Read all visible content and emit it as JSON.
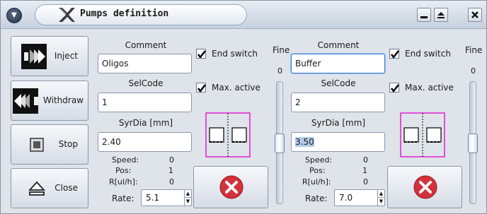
{
  "window": {
    "title": "Pumps definition"
  },
  "actions": {
    "inject": "Inject",
    "withdraw": "Withdraw",
    "stop": "Stop",
    "close": "Close"
  },
  "pumps": [
    {
      "comment_label": "Comment",
      "comment_value": "Oligos",
      "end_switch_label": "End switch",
      "end_switch_checked": true,
      "selcode_label": "SelCode",
      "selcode_value": "1",
      "max_active_label": "Max. active",
      "max_active_checked": true,
      "syrdia_label": "SyrDia [mm]",
      "syrdia_value": "2.40",
      "speed_label": "Speed:",
      "speed_value": "0",
      "pos_label": "Pos:",
      "pos_value": "1",
      "rate_unit_label": "R[ul/h]:",
      "rate_unit_value": "0",
      "rate_label": "Rate:",
      "rate_value": "5.1",
      "fine_label": "Fine",
      "fine_value": "0"
    },
    {
      "comment_label": "Comment",
      "comment_value": "Buffer",
      "end_switch_label": "End switch",
      "end_switch_checked": true,
      "selcode_label": "SelCode",
      "selcode_value": "2",
      "max_active_label": "Max. active",
      "max_active_checked": true,
      "syrdia_label": "SyrDia [mm]",
      "syrdia_value": "3.50",
      "speed_label": "Speed:",
      "speed_value": "0",
      "pos_label": "Pos:",
      "pos_value": "1",
      "rate_unit_label": "R[ul/h]:",
      "rate_unit_value": "0",
      "rate_label": "Rate:",
      "rate_value": "7.0",
      "fine_label": "Fine",
      "fine_value": "0"
    }
  ],
  "icons": {
    "menu": "chevron-down-icon",
    "app": "x-logo-icon",
    "minimize": "minimize-icon",
    "maximize": "maximize-icon",
    "close": "close-icon",
    "inject": "inject-arrow-icon",
    "withdraw": "withdraw-arrow-icon",
    "stop": "stop-square-icon",
    "eject": "eject-icon",
    "cancel": "cancel-x-icon"
  },
  "colors": {
    "accent": "#3a7bd5",
    "pump_outline": "#e020d0",
    "cancel_red": "#d4313a"
  }
}
